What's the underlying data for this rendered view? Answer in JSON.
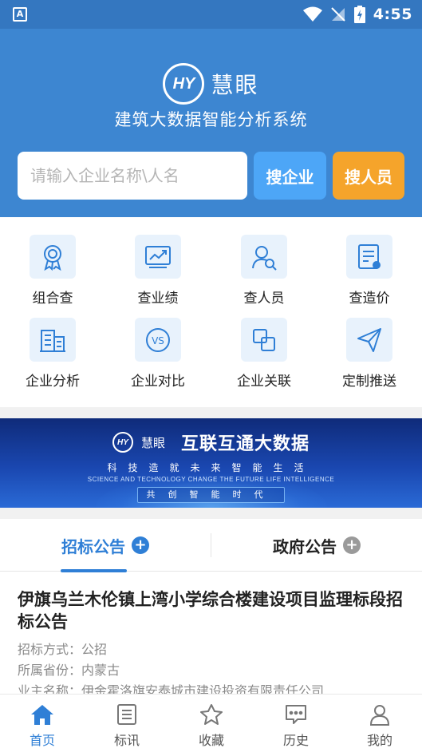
{
  "status_bar": {
    "app_badge": "A",
    "time": "4:55"
  },
  "header": {
    "logo_text": "HY",
    "brand_name": "慧眼",
    "subtitle": "建筑大数据智能分析系统",
    "search_placeholder": "请输入企业名称\\人名",
    "search_company_label": "搜企业",
    "search_person_label": "搜人员"
  },
  "functions": [
    {
      "label": "组合查",
      "icon": "award-icon"
    },
    {
      "label": "查业绩",
      "icon": "chart-icon"
    },
    {
      "label": "查人员",
      "icon": "person-search-icon"
    },
    {
      "label": "查造价",
      "icon": "document-gear-icon"
    },
    {
      "label": "企业分析",
      "icon": "building-icon"
    },
    {
      "label": "企业对比",
      "icon": "vs-icon"
    },
    {
      "label": "企业关联",
      "icon": "link-squares-icon"
    },
    {
      "label": "定制推送",
      "icon": "paper-plane-icon"
    }
  ],
  "banner": {
    "logo_text": "HY",
    "brand": "慧眼",
    "title": "互联互通大数据",
    "slogan": "科技造就未来智能生活",
    "slogan_en": "SCIENCE AND TECHNOLOGY CHANGE THE FUTURE LIFE INTELLIGENCE",
    "pill": "共创智能时代"
  },
  "tabs": [
    {
      "label": "招标公告",
      "active": true
    },
    {
      "label": "政府公告",
      "active": false
    }
  ],
  "announcement": {
    "title": "伊旗乌兰木伦镇上湾小学综合楼建设项目监理标段招标公告",
    "rows": [
      {
        "key": "招标方式：",
        "value": "公招"
      },
      {
        "key": "所属省份：",
        "value": "内蒙古"
      },
      {
        "key": "业主名称：",
        "value": "伊金霍洛旗安泰城市建设投资有限责任公司"
      }
    ]
  },
  "bottom_nav": [
    {
      "label": "首页",
      "icon": "home-icon",
      "active": true
    },
    {
      "label": "标讯",
      "icon": "list-doc-icon",
      "active": false
    },
    {
      "label": "收藏",
      "icon": "star-icon",
      "active": false
    },
    {
      "label": "历史",
      "icon": "chat-icon",
      "active": false
    },
    {
      "label": "我的",
      "icon": "user-icon",
      "active": false
    }
  ],
  "colors": {
    "primary": "#3d86d1",
    "accent_orange": "#f5a42b",
    "accent_blue": "#4da6f7",
    "active_tab": "#2f7fd6"
  }
}
